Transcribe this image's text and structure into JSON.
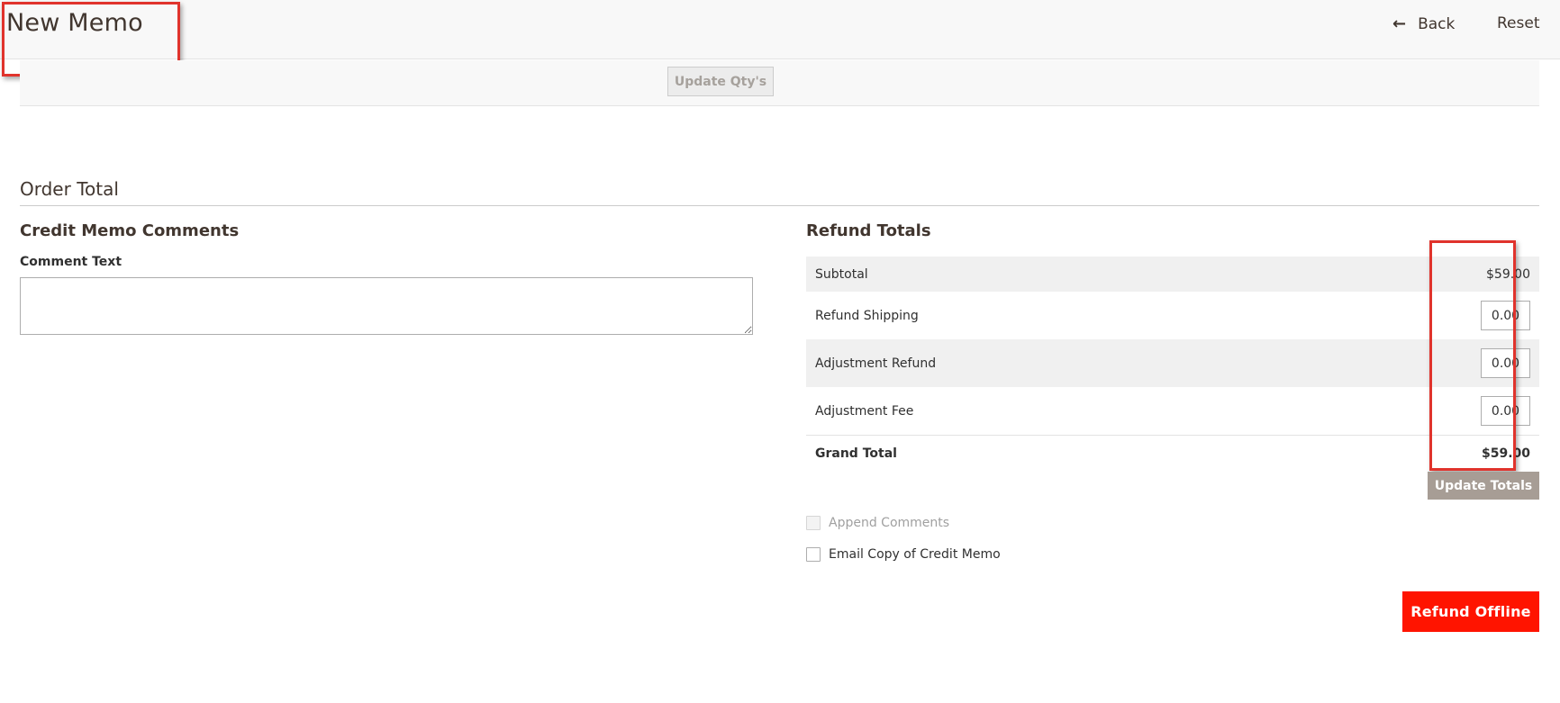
{
  "header": {
    "title": "New Memo",
    "back_icon": "arrow-left-icon",
    "back_label": "Back",
    "reset_label": "Reset"
  },
  "items_bar": {
    "update_qty_label": "Update Qty's"
  },
  "order_total": {
    "section_title": "Order Total",
    "comments": {
      "title": "Credit Memo Comments",
      "comment_label": "Comment Text",
      "comment_value": ""
    },
    "refund_totals": {
      "title": "Refund Totals",
      "rows": [
        {
          "label": "Subtotal",
          "value": "$59.00"
        },
        {
          "label": "Refund Shipping",
          "input_value": "0.00"
        },
        {
          "label": "Adjustment Refund",
          "input_value": "0.00"
        },
        {
          "label": "Adjustment Fee",
          "input_value": "0.00"
        }
      ],
      "grand_total_label": "Grand Total",
      "grand_total_value": "$59.00",
      "update_totals_label": "Update Totals"
    },
    "options": {
      "append_comments_label": "Append Comments",
      "append_comments_checked": false,
      "append_comments_disabled": true,
      "email_copy_label": "Email Copy of Credit Memo",
      "email_copy_checked": false
    },
    "refund_offline_label": "Refund Offline"
  },
  "colors": {
    "primary_action": "#ff1400",
    "highlight_box": "#e0332c",
    "disabled_button": "#a79d95"
  }
}
